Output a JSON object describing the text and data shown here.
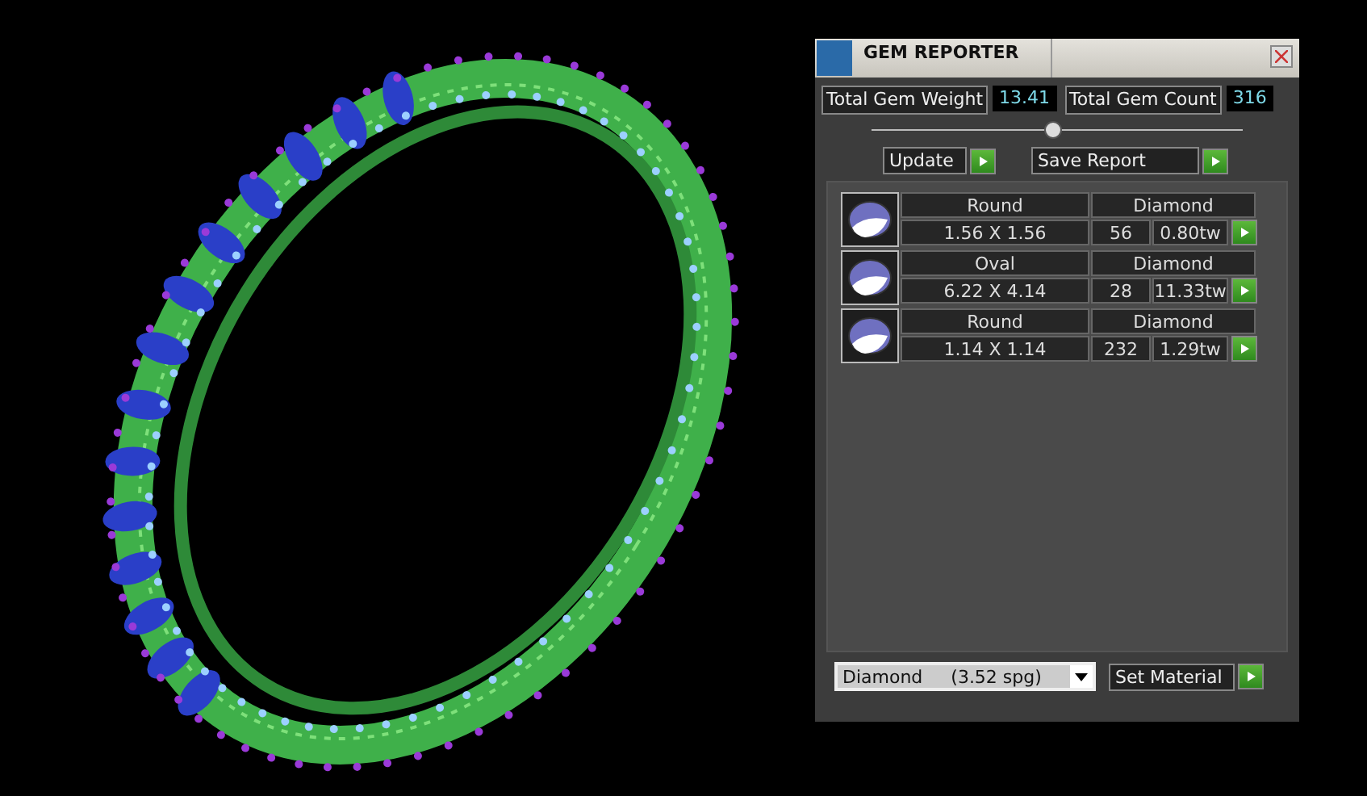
{
  "window": {
    "title": "GEM REPORTER"
  },
  "totals": {
    "weight_label": "Total Gem Weight",
    "weight": "13.41",
    "count_label": "Total Gem Count",
    "count": "316"
  },
  "buttons": {
    "update": "Update",
    "save": "Save Report"
  },
  "gems": [
    {
      "shape": "Round",
      "size": "1.56 X 1.56",
      "material": "Diamond",
      "count": "56",
      "weight": "0.80tw"
    },
    {
      "shape": "Oval",
      "size": "6.22 X 4.14",
      "material": "Diamond",
      "count": "28",
      "weight": "11.33tw"
    },
    {
      "shape": "Round",
      "size": "1.14 X 1.14",
      "material": "Diamond",
      "count": "232",
      "weight": "1.29tw"
    }
  ],
  "material_select": {
    "value": "Diamond     (3.52 spg)"
  },
  "set_material": "Set Material"
}
